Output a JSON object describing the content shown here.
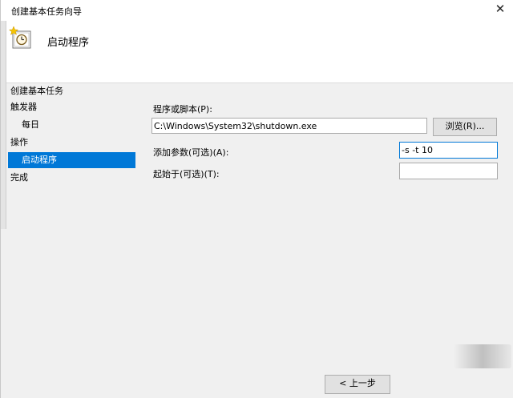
{
  "window": {
    "title": "创建基本任务向导",
    "close_glyph": "✕"
  },
  "header": {
    "title": "启动程序",
    "icon": "task-scheduler-clock-icon"
  },
  "sidebar": {
    "items": [
      {
        "label": "创建基本任务",
        "indent": false,
        "selected": false
      },
      {
        "label": "触发器",
        "indent": false,
        "selected": false
      },
      {
        "label": "每日",
        "indent": true,
        "selected": false
      },
      {
        "label": "操作",
        "indent": false,
        "selected": false
      },
      {
        "label": "启动程序",
        "indent": true,
        "selected": true
      },
      {
        "label": "完成",
        "indent": false,
        "selected": false
      }
    ]
  },
  "form": {
    "program_label": "程序或脚本(P):",
    "program_value": "C:\\Windows\\System32\\shutdown.exe",
    "browse_label": "浏览(R)...",
    "args_label": "添加参数(可选)(A):",
    "args_value": "-s -t 10",
    "startin_label": "起始于(可选)(T):",
    "startin_value": ""
  },
  "footer": {
    "back_label": "< 上一步"
  },
  "colors": {
    "selection": "#0078d7",
    "window_bg": "#f0f0f0"
  }
}
